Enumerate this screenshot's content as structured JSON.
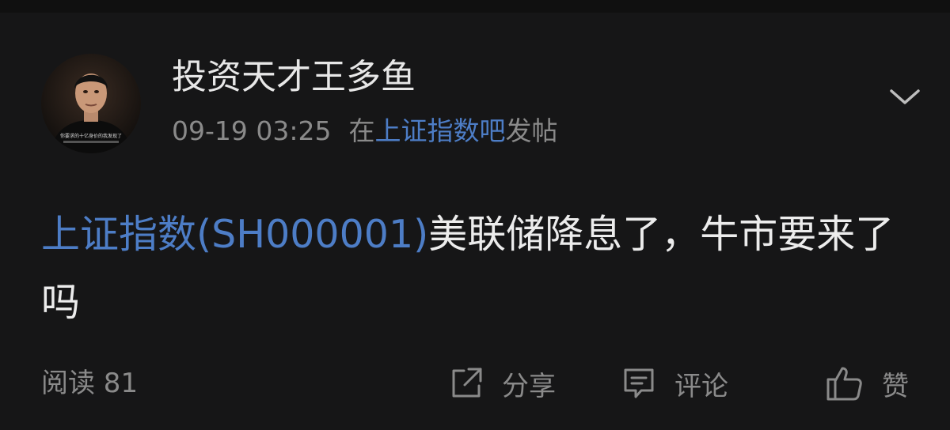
{
  "post": {
    "author": {
      "name": "投资天才王多鱼",
      "avatar_icon": "user-avatar-photo",
      "avatar_caption": "你要求的十亿身价的我发现了"
    },
    "meta": {
      "datetime": "09-19 03:25",
      "prefix": "在",
      "forum": "上证指数吧",
      "suffix": "发帖"
    },
    "menu_icon": "chevron-down-icon",
    "content": {
      "stock_link": "上证指数(SH000001)",
      "text": "美联储降息了，牛市要来了吗"
    },
    "footer": {
      "reads_label": "阅读 81",
      "share_label": "分享",
      "comment_label": "评论",
      "like_label": "赞"
    }
  },
  "colors": {
    "background": "#161617",
    "link": "#4d7dc6",
    "primary_text": "#e7e7e7",
    "secondary_text": "#8a8a8a"
  }
}
